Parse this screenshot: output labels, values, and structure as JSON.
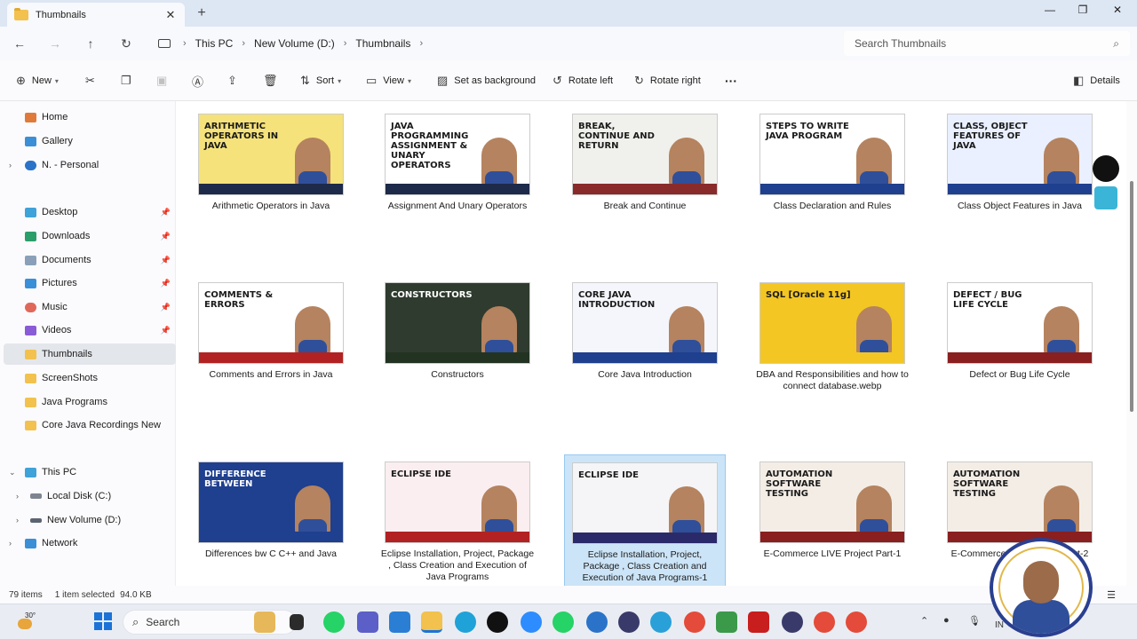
{
  "window": {
    "tab_title": "Thumbnails",
    "tab_close": "✕",
    "new_tab": "+",
    "minimize": "—",
    "maximize": "❐",
    "close": "✕"
  },
  "address": {
    "breadcrumbs": [
      "This PC",
      "New Volume (D:)",
      "Thumbnails"
    ],
    "separator": "›",
    "search_placeholder": "Search Thumbnails"
  },
  "toolbar": {
    "new_label": "New",
    "sort_label": "Sort",
    "view_label": "View",
    "set_background_label": "Set as background",
    "rotate_left_label": "Rotate left",
    "rotate_right_label": "Rotate right",
    "more_label": "···",
    "details_label": "Details"
  },
  "sidebar": {
    "items": [
      {
        "label": "Home",
        "icon": "home-icon"
      },
      {
        "label": "Gallery",
        "icon": "gallery-icon"
      },
      {
        "label": "N. - Personal",
        "icon": "cloud-icon"
      },
      {
        "label": "Desktop",
        "icon": "desktop-icon"
      },
      {
        "label": "Downloads",
        "icon": "download-icon"
      },
      {
        "label": "Documents",
        "icon": "documents-icon"
      },
      {
        "label": "Pictures",
        "icon": "pictures-icon"
      },
      {
        "label": "Music",
        "icon": "music-icon"
      },
      {
        "label": "Videos",
        "icon": "videos-icon"
      },
      {
        "label": "Thumbnails",
        "icon": "folder-icon"
      },
      {
        "label": "ScreenShots",
        "icon": "folder-icon"
      },
      {
        "label": "Java Programs",
        "icon": "folder-icon"
      },
      {
        "label": "Core Java Recordings New",
        "icon": "folder-icon"
      },
      {
        "label": "This PC",
        "icon": "computer-icon"
      },
      {
        "label": "Local Disk (C:)",
        "icon": "drive-icon"
      },
      {
        "label": "New Volume (D:)",
        "icon": "drive-icon"
      },
      {
        "label": "Network",
        "icon": "network-icon"
      }
    ]
  },
  "files": [
    {
      "name": "Arithmetic Operators in Java",
      "thumb_text": "ARITHMETIC OPERATORS IN JAVA",
      "bg": "#f5e27a",
      "strip": "#1e2a4a"
    },
    {
      "name": "Assignment And Unary Operators",
      "thumb_text": "JAVA PROGRAMMING  ASSIGNMENT & UNARY OPERATORS",
      "bg": "#ffffff",
      "strip": "#1e2a4a"
    },
    {
      "name": "Break and Continue",
      "thumb_text": "BREAK, CONTINUE AND RETURN",
      "bg": "#f0f0ec",
      "strip": "#8a2b2b"
    },
    {
      "name": "Class Declaration and Rules",
      "thumb_text": "STEPS TO WRITE JAVA PROGRAM",
      "bg": "#ffffff",
      "strip": "#1f3f8f"
    },
    {
      "name": "Class Object Features in Java",
      "thumb_text": "CLASS, OBJECT FEATURES OF JAVA",
      "bg": "#eaf0ff",
      "strip": "#1f3f8f"
    },
    {
      "name": "Comments and Errors in Java",
      "thumb_text": "COMMENTS & ERRORS",
      "bg": "#ffffff",
      "strip": "#b22222"
    },
    {
      "name": "Constructors",
      "thumb_text": "CONSTRUCTORS",
      "bg": "#2e3b2e",
      "strip": "#223322"
    },
    {
      "name": "Core Java Introduction",
      "thumb_text": "CORE JAVA INTRODUCTION",
      "bg": "#f4f6fb",
      "strip": "#1f3f8f"
    },
    {
      "name": "DBA and Responsibilities and how to connect database.webp",
      "thumb_text": "SQL [Oracle 11g]",
      "bg": "#f3c623",
      "strip": "#f3c623"
    },
    {
      "name": "Defect or Bug Life Cycle",
      "thumb_text": "DEFECT / BUG LIFE CYCLE",
      "bg": "#ffffff",
      "strip": "#8a1f1f"
    },
    {
      "name": "Differences bw C C++ and Java",
      "thumb_text": "DIFFERENCE BETWEEN",
      "bg": "#1f3f8f",
      "strip": "#1f3f8f"
    },
    {
      "name": "Eclipse Installation, Project, Package , Class Creation and Execution of Java Programs",
      "thumb_text": "ECLIPSE IDE",
      "bg": "#fbeef0",
      "strip": "#b22222"
    },
    {
      "name": "Eclipse Installation, Project, Package , Class Creation and Execution of Java Programs-1",
      "thumb_text": "ECLIPSE IDE",
      "bg": "#f5f5f7",
      "strip": "#2a2a6a"
    },
    {
      "name": "E-Commerce LIVE Project Part-1",
      "thumb_text": "AUTOMATION SOFTWARE TESTING",
      "bg": "#f3ede6",
      "strip": "#8a1f1f"
    },
    {
      "name": "E-Commerce LIVE Project Part-2",
      "thumb_text": "AUTOMATION SOFTWARE TESTING",
      "bg": "#f3ede6",
      "strip": "#8a1f1f"
    }
  ],
  "status": {
    "count": "79 items",
    "selection": "1 item selected",
    "size": "94.0 KB"
  },
  "taskbar": {
    "temperature": "30°",
    "search_label": "Search",
    "lang": "IN"
  },
  "colors": {
    "accent": "#1b73d8",
    "selection": "#cce4f7"
  }
}
